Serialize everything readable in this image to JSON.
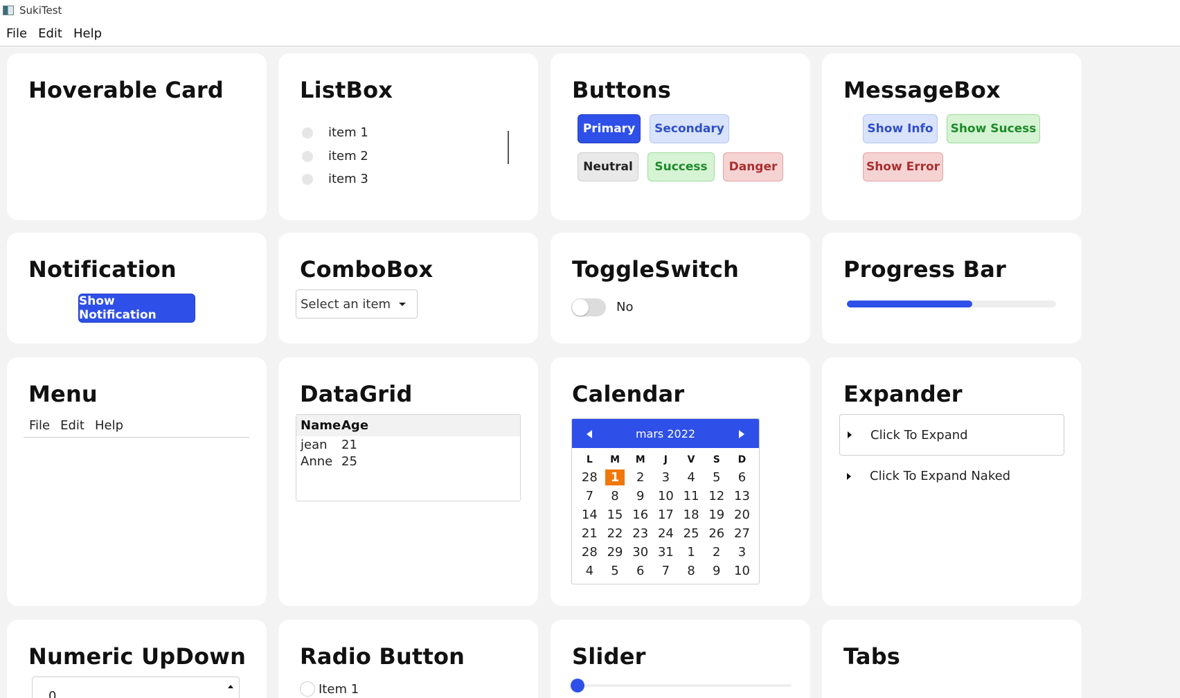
{
  "window": {
    "title": "SukiTest"
  },
  "menubar": {
    "items": [
      "File",
      "Edit",
      "Help"
    ]
  },
  "cards": {
    "hoverable": {
      "title": "Hoverable Card"
    },
    "listbox": {
      "title": "ListBox",
      "items": [
        "item 1",
        "item 2",
        "item 3"
      ]
    },
    "buttons": {
      "title": "Buttons",
      "primary": "Primary",
      "secondary": "Secondary",
      "neutral": "Neutral",
      "success": "Success",
      "danger": "Danger"
    },
    "messagebox": {
      "title": "MessageBox",
      "info": "Show Info",
      "success": "Show Sucess",
      "error": "Show Error"
    },
    "notification": {
      "title": "Notification",
      "button": "Show Notification"
    },
    "combobox": {
      "title": "ComboBox",
      "placeholder": "Select an item"
    },
    "toggle": {
      "title": "ToggleSwitch",
      "label": "No",
      "checked": false
    },
    "progress": {
      "title": "Progress Bar",
      "value_percent": 60
    },
    "menu": {
      "title": "Menu",
      "items": [
        "File",
        "Edit",
        "Help"
      ]
    },
    "datagrid": {
      "title": "DataGrid",
      "columns": [
        "Name",
        "Age"
      ],
      "rows": [
        [
          "jean",
          "21"
        ],
        [
          "Anne",
          "25"
        ]
      ]
    },
    "calendar": {
      "title": "Calendar",
      "month": "mars 2022",
      "days_of_week": [
        "L",
        "M",
        "M",
        "J",
        "V",
        "S",
        "D"
      ],
      "weeks": [
        [
          "28",
          "1",
          "2",
          "3",
          "4",
          "5",
          "6"
        ],
        [
          "7",
          "8",
          "9",
          "10",
          "11",
          "12",
          "13"
        ],
        [
          "14",
          "15",
          "16",
          "17",
          "18",
          "19",
          "20"
        ],
        [
          "21",
          "22",
          "23",
          "24",
          "25",
          "26",
          "27"
        ],
        [
          "28",
          "29",
          "30",
          "31",
          "1",
          "2",
          "3"
        ],
        [
          "4",
          "5",
          "6",
          "7",
          "8",
          "9",
          "10"
        ]
      ],
      "selected": "1"
    },
    "expander": {
      "title": "Expander",
      "expand_label": "Click To Expand",
      "expand_naked_label": "Click To Expand Naked"
    },
    "numeric": {
      "title": "Numeric UpDown",
      "value": "0"
    },
    "radio": {
      "title": "Radio Button",
      "item": "Item 1"
    },
    "slider": {
      "title": "Slider",
      "value": 0
    },
    "tabs": {
      "title": "Tabs"
    }
  },
  "colors": {
    "accent": "#2e50e8",
    "today": "#f0780a",
    "success": "#1e8a2a",
    "danger": "#a83030"
  }
}
